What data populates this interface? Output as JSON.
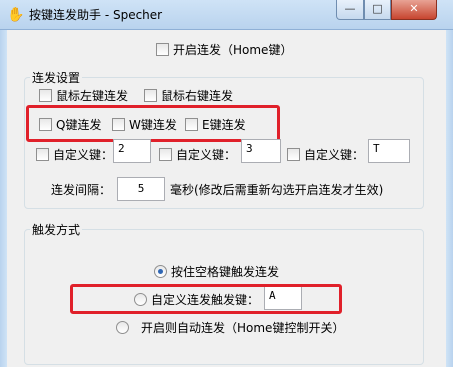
{
  "window": {
    "title": "按键连发助手 - Specher",
    "app_icon": "hand-icon",
    "minimize_glyph": "—",
    "maximize_glyph": "□",
    "close_glyph": "✕"
  },
  "top": {
    "enable_label": "开启连发（Home键）"
  },
  "repeat_settings": {
    "title": "连发设置",
    "mouse_left_label": "鼠标左键连发",
    "mouse_right_label": "鼠标右键连发",
    "q_label": "Q键连发",
    "w_label": "W键连发",
    "e_label": "E键连发",
    "custom1_label": "自定义键：",
    "custom1_value": "2",
    "custom2_label": "自定义键：",
    "custom2_value": "3",
    "custom3_label": "自定义键：",
    "custom3_value": "T",
    "interval_label": "连发间隔：",
    "interval_value": "5",
    "interval_note": "毫秒(修改后需重新勾选开启连发才生效)"
  },
  "trigger": {
    "title": "触发方式",
    "option_space_label": "按住空格键触发连发",
    "option_custom_label": "自定义连发触发键：",
    "option_custom_value": "A",
    "option_auto_label": "开启则自动连发（Home键控制开关）"
  },
  "colors": {
    "highlight": "#e0202a",
    "titlebar": "#b9d3ee"
  }
}
